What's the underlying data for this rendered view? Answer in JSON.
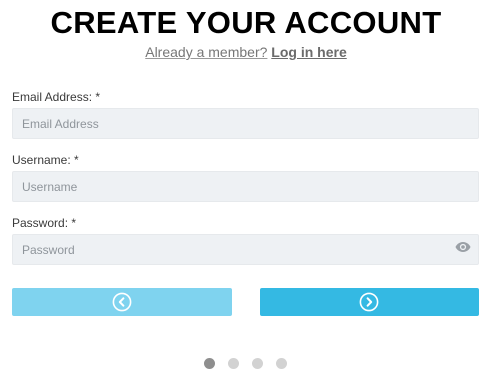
{
  "header": {
    "title": "CREATE YOUR ACCOUNT",
    "member_prompt": "Already a member?",
    "login_link": "Log in here"
  },
  "form": {
    "email": {
      "label": "Email Address: *",
      "placeholder": "Email Address",
      "value": ""
    },
    "username": {
      "label": "Username: *",
      "placeholder": "Username",
      "value": ""
    },
    "password": {
      "label": "Password: *",
      "placeholder": "Password",
      "value": ""
    }
  },
  "icons": {
    "password_toggle": "eye-icon",
    "prev": "chevron-left-circle-icon",
    "next": "chevron-right-circle-icon"
  },
  "steps": {
    "total": 4,
    "current": 1
  },
  "colors": {
    "prev_button": "#7fd3ef",
    "next_button": "#34b9e3",
    "input_background": "#eef1f4",
    "dot_active": "#8e8e8e",
    "dot_inactive": "#d2d2d2"
  }
}
